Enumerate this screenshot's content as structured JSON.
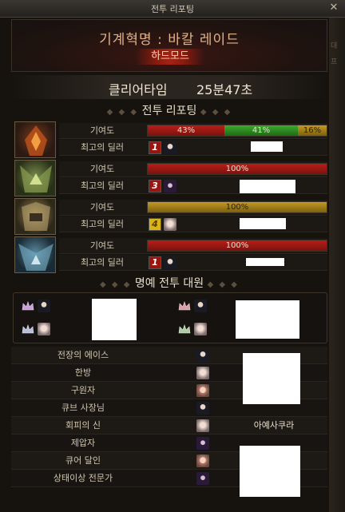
{
  "window": {
    "title": "전투 리포팅",
    "close_icon": "close-icon"
  },
  "header": {
    "raid_name": "기계혁명 : 바칼 레이드",
    "difficulty": "하드모드"
  },
  "clear": {
    "label": "클리어타임",
    "value": "25분47초"
  },
  "report_section": {
    "title": "전투 리포팅"
  },
  "row_labels": {
    "contribution": "기여도",
    "best_dealer": "최고의 딜러"
  },
  "bosses": [
    {
      "portrait": "red-boss-portrait",
      "segments": [
        {
          "label": "43%",
          "value": 0.43,
          "color": "#b71f18"
        },
        {
          "label": "41%",
          "value": 0.41,
          "color": "#3bab2b"
        },
        {
          "label": "16%",
          "value": 0.16,
          "color": "#c29a23"
        }
      ],
      "dealer_class": "1",
      "class_color": "red"
    },
    {
      "portrait": "green-boss-portrait",
      "segments": [
        {
          "label": "100%",
          "value": 1.0,
          "color": "#b71f18"
        }
      ],
      "dealer_class": "3",
      "class_color": "red"
    },
    {
      "portrait": "gold-boss-portrait",
      "segments": [
        {
          "label": "100%",
          "value": 1.0,
          "color": "#c29a23"
        }
      ],
      "dealer_class": "4",
      "class_color": "yellow"
    },
    {
      "portrait": "blue-boss-portrait",
      "segments": [
        {
          "label": "100%",
          "value": 1.0,
          "color": "#b71f18"
        }
      ],
      "dealer_class": "1",
      "class_color": "red"
    }
  ],
  "honor_section": {
    "title": "명예 전투 대원"
  },
  "titles": [
    {
      "label": "전장의 에이스",
      "name": ""
    },
    {
      "label": "한방",
      "name": ""
    },
    {
      "label": "구원자",
      "name": ""
    },
    {
      "label": "큐브 사장님",
      "name": ""
    },
    {
      "label": "회피의 신",
      "name": "아예사쿠라"
    },
    {
      "label": "제압자",
      "name": ""
    },
    {
      "label": "큐어 달인",
      "name": ""
    },
    {
      "label": "상태이상 전문가",
      "name": ""
    }
  ]
}
